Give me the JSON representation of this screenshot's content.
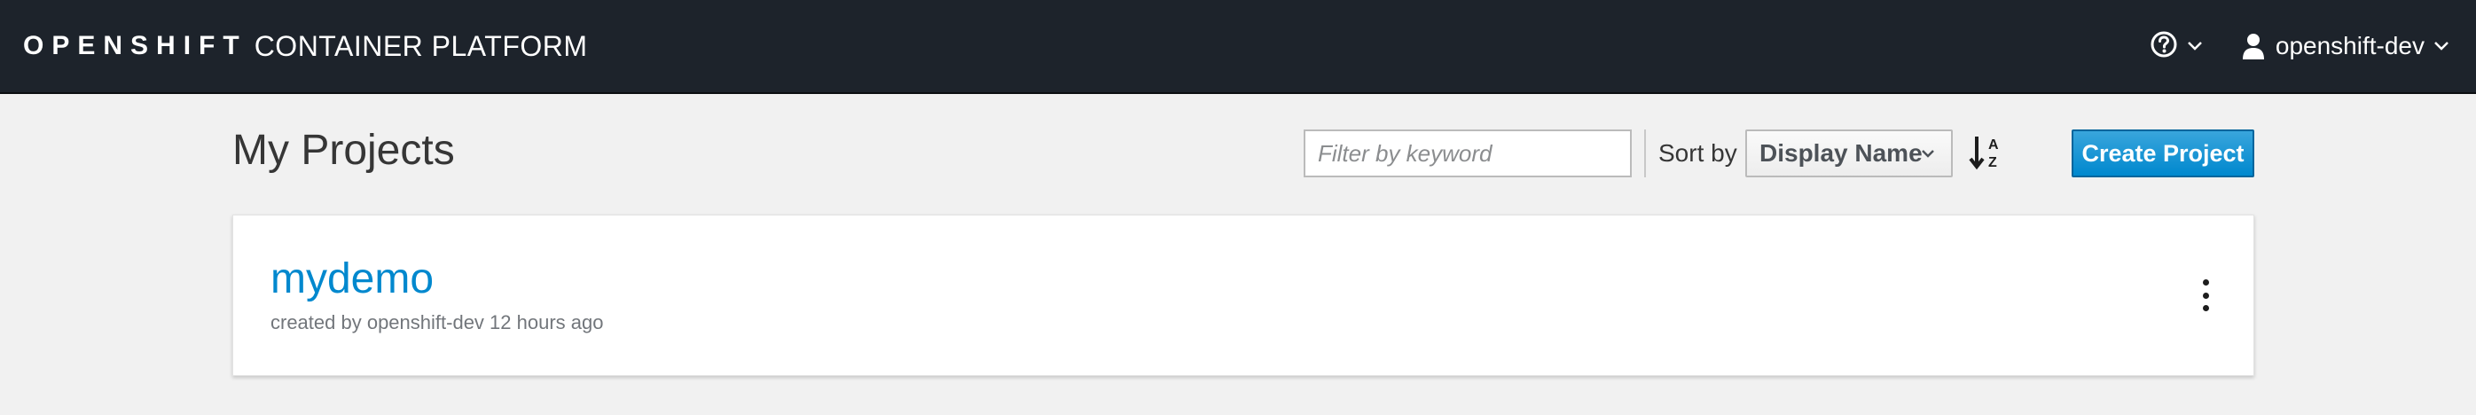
{
  "navbar": {
    "brand_bold": "OPENSHIFT",
    "brand_light": "CONTAINER PLATFORM",
    "help_icon": "question-circle-icon",
    "user": {
      "icon": "user-icon",
      "name": "openshift-dev"
    }
  },
  "page": {
    "title": "My Projects"
  },
  "toolbar": {
    "filter_placeholder": "Filter by keyword",
    "filter_value": "",
    "sort_label": "Sort by",
    "sort_selected": "Display Name",
    "sort_order_icon": "sort-alpha-asc-icon",
    "create_label": "Create Project"
  },
  "projects": [
    {
      "name": "mydemo",
      "meta": "created by openshift-dev 12 hours ago",
      "actions_icon": "kebab-menu-icon"
    }
  ],
  "colors": {
    "navbar_bg": "#1d232b",
    "page_bg": "#f1f1f1",
    "link": "#0088ce",
    "primary_button": "#0088ce"
  }
}
